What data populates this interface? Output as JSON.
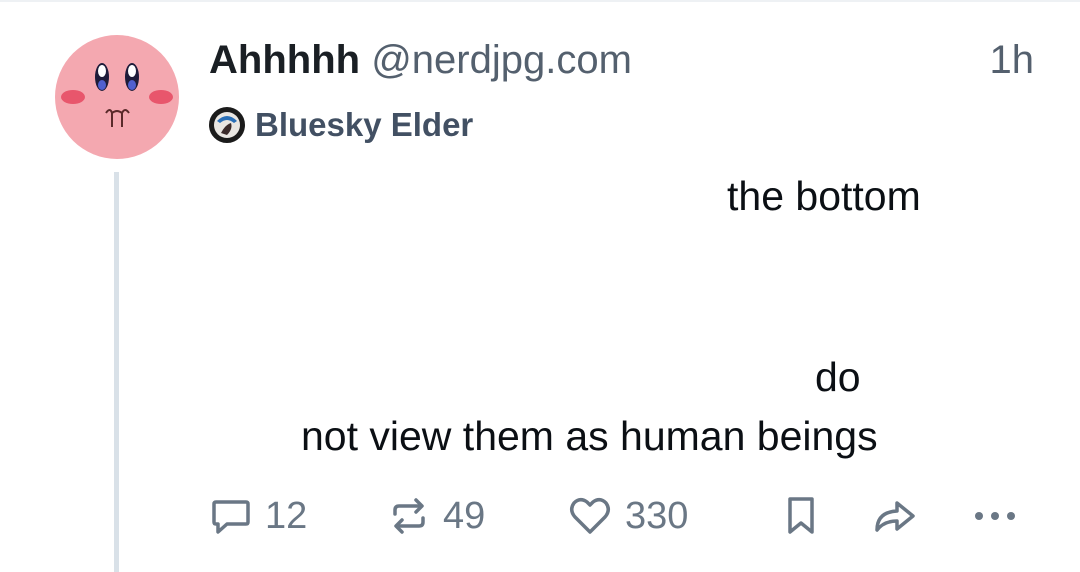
{
  "post": {
    "author": {
      "display_name": "Ahhhhh",
      "handle": "@nerdjpg.com",
      "avatar": "kirby-face-avatar"
    },
    "time": "1h",
    "badge": {
      "label": "Bluesky Elder",
      "icon": "badge-avatar-icon"
    },
    "text_lines": [
      "the bottom",
      "do",
      "not view them as human beings"
    ],
    "actions": {
      "replies": "12",
      "reposts": "49",
      "likes": "330"
    }
  },
  "colors": {
    "text": "#0b0f14",
    "muted": "#54606e",
    "icon": "#6a7785",
    "thread_line": "#d9e1e8",
    "avatar_pink": "#f4a5ad"
  }
}
